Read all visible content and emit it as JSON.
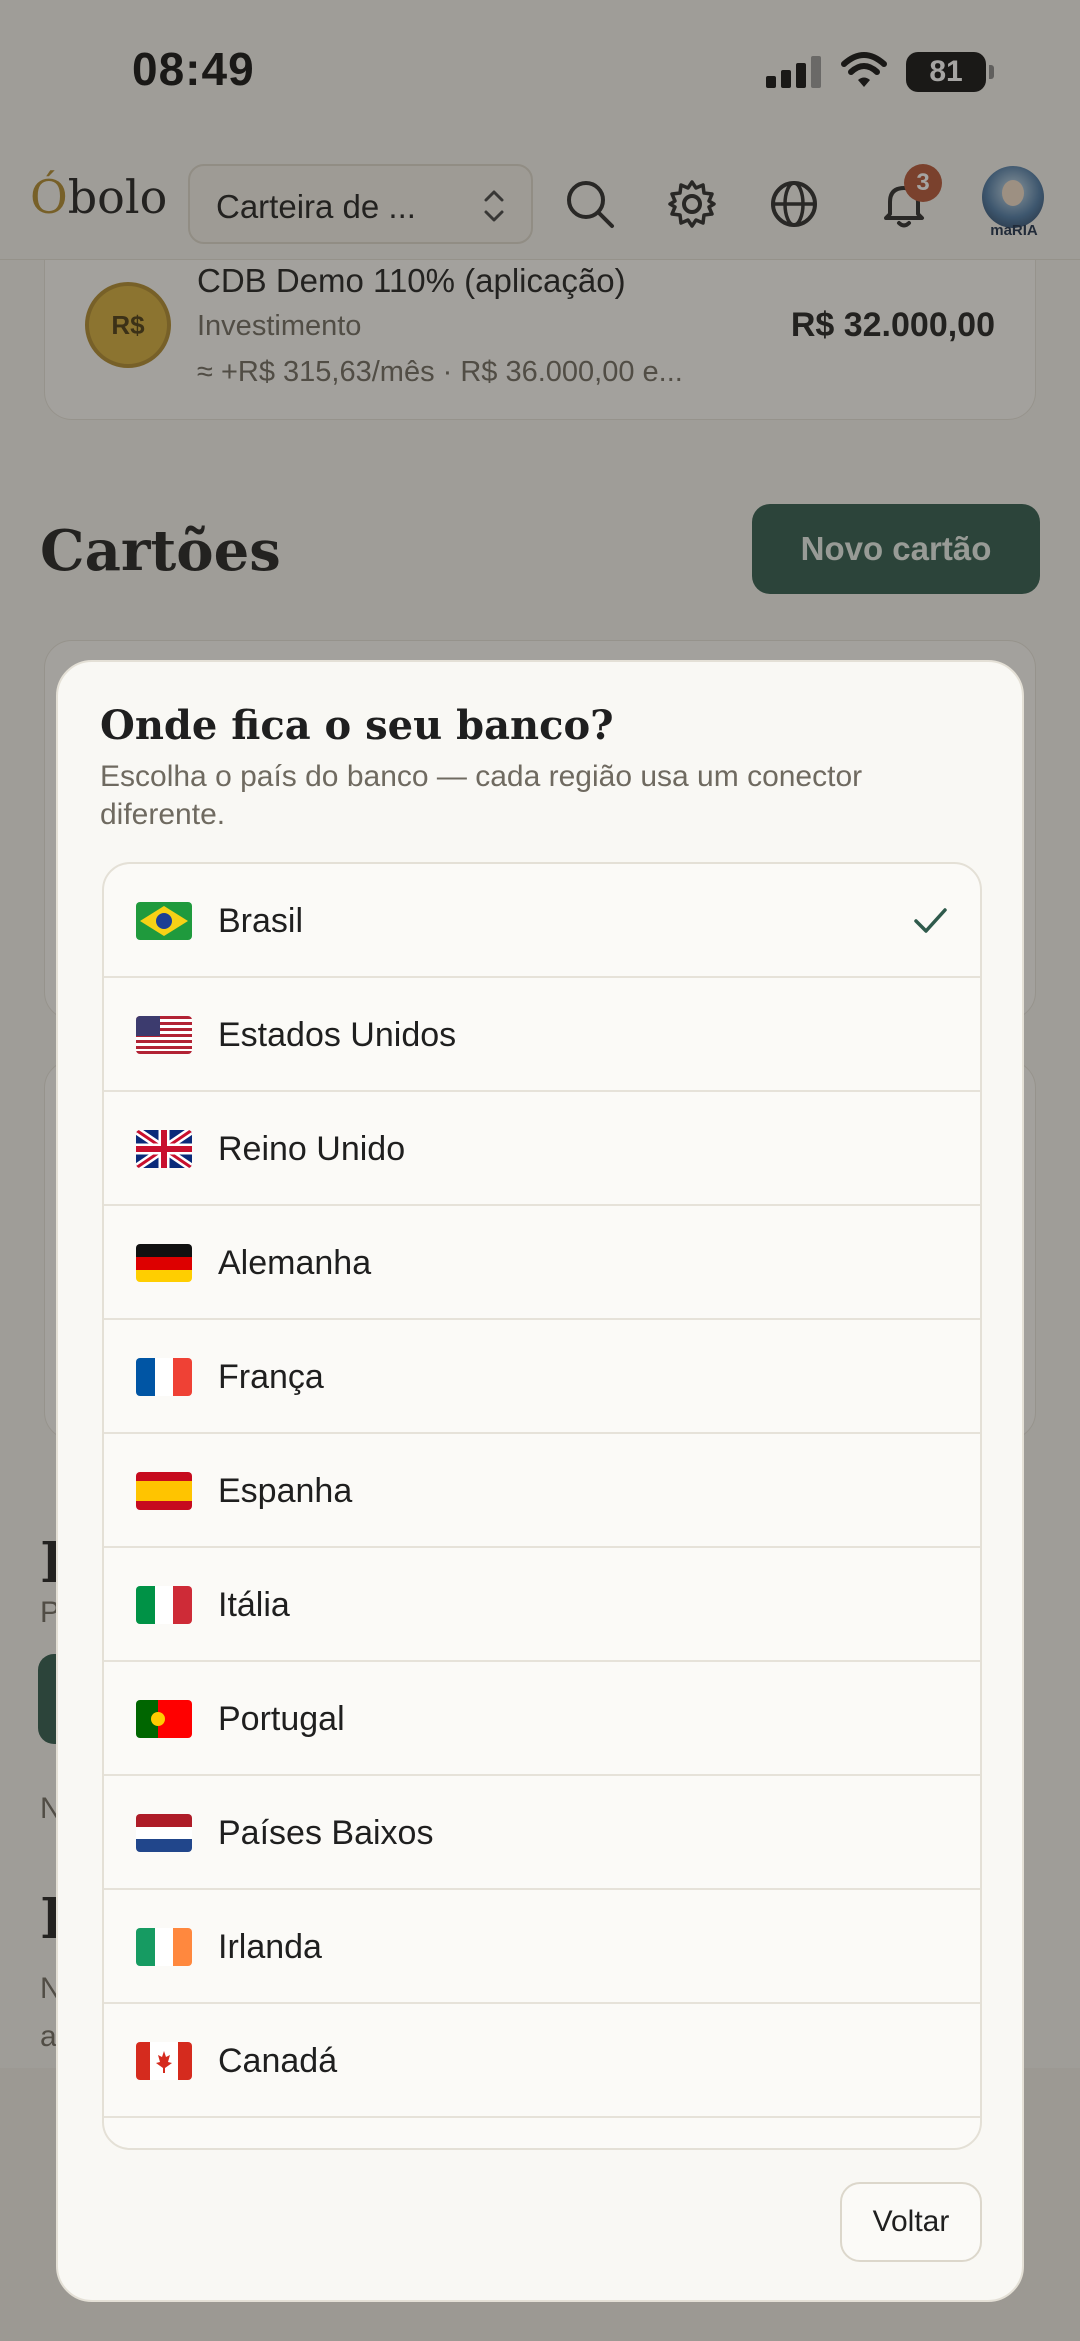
{
  "status_bar": {
    "time": "08:49",
    "battery": "81"
  },
  "header": {
    "logo_first": "Ó",
    "logo_rest": "bolo",
    "wallet_selector": "Carteira de ...",
    "notifications_count": "3",
    "avatar_label": "maRIA",
    "icons": [
      "search-icon",
      "gear-icon",
      "globe-icon",
      "bell-icon"
    ]
  },
  "investment": {
    "coin_label": "R$",
    "name": "CDB Demo 110% (aplicação)",
    "type": "Investimento",
    "extra": "≈ +R$ 315,63/mês · R$ 36.000,00 e...",
    "value": "R$ 32.000,00"
  },
  "cards_section": {
    "title": "Cartões",
    "new_card_button": "Novo cartão"
  },
  "background_fragments": {
    "heading_a": "I",
    "text_a": "P",
    "text_b": "N",
    "heading_b": "F",
    "text_c": "N",
    "text_d": "a"
  },
  "modal": {
    "title": "Onde fica o seu banco?",
    "subtitle": "Escolha o país do banco — cada região usa um conector diferente.",
    "selected": "Brasil",
    "countries": [
      {
        "name": "Brasil",
        "flag": "brazil-flag"
      },
      {
        "name": "Estados Unidos",
        "flag": "usa-flag"
      },
      {
        "name": "Reino Unido",
        "flag": "uk-flag"
      },
      {
        "name": "Alemanha",
        "flag": "germany-flag"
      },
      {
        "name": "França",
        "flag": "france-flag"
      },
      {
        "name": "Espanha",
        "flag": "spain-flag"
      },
      {
        "name": "Itália",
        "flag": "italy-flag"
      },
      {
        "name": "Portugal",
        "flag": "portugal-flag"
      },
      {
        "name": "Países Baixos",
        "flag": "netherlands-flag"
      },
      {
        "name": "Irlanda",
        "flag": "ireland-flag"
      },
      {
        "name": "Canadá",
        "flag": "canada-flag"
      }
    ],
    "back_button": "Voltar"
  },
  "colors": {
    "accent_green": "#2f5a4c",
    "gold": "#b08a2e",
    "badge": "#b65536",
    "background": "#f5f3ee"
  }
}
